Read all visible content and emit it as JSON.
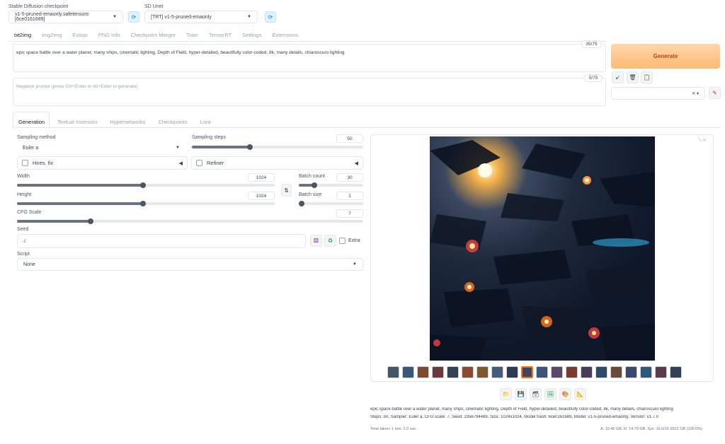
{
  "header": {
    "checkpoint_label": "Stable Diffusion checkpoint",
    "checkpoint_value": "v1-5-pruned-emaonly.safetensors [6ce0161689]",
    "unet_label": "SD Unet",
    "unet_value": "[TRT] v1-5-pruned-emaonly"
  },
  "main_tabs": [
    "txt2img",
    "img2img",
    "Extras",
    "PNG Info",
    "Checkpoint Merger",
    "Train",
    "TensorRT",
    "Settings",
    "Extensions"
  ],
  "prompt": {
    "text": "epic space battle over a water planet, many ships, cinematic lighting, Depth of Field, hyper-detailed, beautifully color-coded, 8k, many details, chiaroscuro lighting",
    "token_count": "35/75",
    "negative_placeholder": "Negative prompt (press Ctrl+Enter or Alt+Enter to generate)",
    "negative_token_count": "0/75"
  },
  "generate_label": "Generate",
  "style_icons": [
    "↙",
    "🗑",
    "📋"
  ],
  "sub_tabs": [
    "Generation",
    "Textual Inversion",
    "Hypernetworks",
    "Checkpoints",
    "Lora"
  ],
  "settings": {
    "sampling_method_label": "Sampling method",
    "sampling_method_value": "Euler a",
    "sampling_steps_label": "Sampling steps",
    "sampling_steps_value": "50",
    "hires_label": "Hires. fix",
    "refiner_label": "Refiner",
    "width_label": "Width",
    "width_value": "1024",
    "height_label": "Height",
    "height_value": "1024",
    "batch_count_label": "Batch count",
    "batch_count_value": "30",
    "batch_size_label": "Batch size",
    "batch_size_value": "1",
    "cfg_label": "CFG Scale",
    "cfg_value": "7",
    "seed_label": "Seed",
    "seed_value": "-1",
    "extra_label": "Extra",
    "script_label": "Script",
    "script_value": "None"
  },
  "output": {
    "info_line1": "epic space battle over a water planet, many ships, cinematic lighting, Depth of Field, hyper-detailed, beautifully color-coded, 8k, many details, chiaroscuro lighting",
    "info_line2": "Steps: 50, Sampler: Euler a, CFG scale: 7, Seed: 3356794489, Size: 1024x1024, Model hash: 6ce0161689, Model: v1-5-pruned-emaonly, Version: v1.7.0",
    "time_taken": "Time taken: 1 min. 2.0 sec.",
    "vram": "A: 10.46 GB, R: 14.79 GB, Sys: 16.0/15.9922 GB (100.0%)"
  },
  "colors": {
    "generate_bg": "#fdba74",
    "generate_text": "#c2410c",
    "accent": "#f97316"
  }
}
